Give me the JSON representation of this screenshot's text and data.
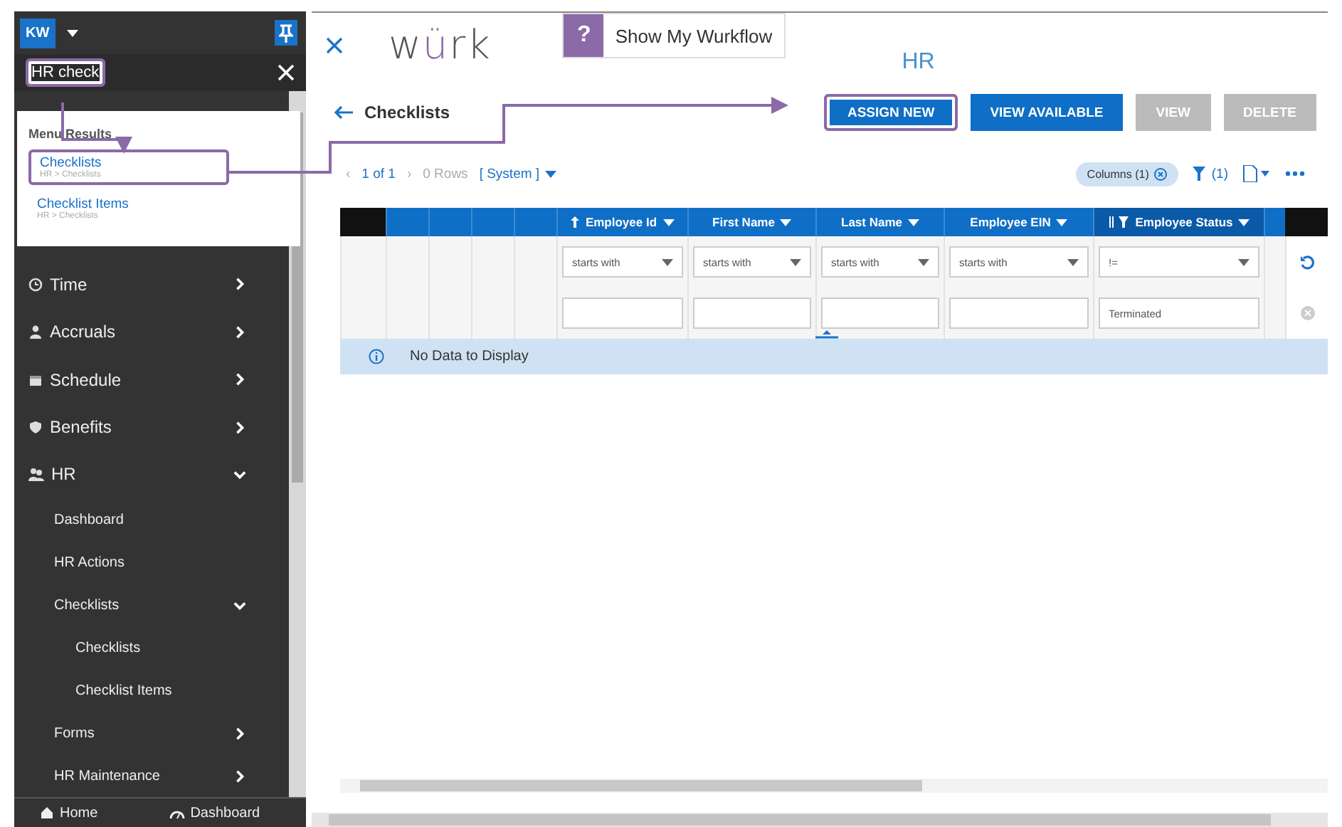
{
  "sidebar": {
    "user_initials": "KW",
    "pinned": true,
    "search": {
      "value": "HR check",
      "highlighted": true
    },
    "search_results": {
      "heading": "Menu Results",
      "items": [
        {
          "label": "Checklists",
          "path": "HR > Checklists",
          "highlighted": true
        },
        {
          "label": "Checklist Items",
          "path": "HR > Checklists",
          "highlighted": false
        }
      ]
    },
    "menu": [
      {
        "label": "Time",
        "expanded": false
      },
      {
        "label": "Accruals",
        "expanded": false
      },
      {
        "label": "Schedule",
        "expanded": false
      },
      {
        "label": "Benefits",
        "expanded": false
      },
      {
        "label": "HR",
        "expanded": true,
        "children": [
          {
            "label": "Dashboard",
            "kind": "link"
          },
          {
            "label": "HR Actions",
            "kind": "link"
          },
          {
            "label": "Checklists",
            "kind": "group",
            "expanded": true,
            "children": [
              {
                "label": "Checklists"
              },
              {
                "label": "Checklist Items"
              }
            ]
          },
          {
            "label": "Forms",
            "kind": "group",
            "expanded": false
          },
          {
            "label": "HR Maintenance",
            "kind": "group",
            "expanded": false
          }
        ]
      }
    ],
    "footer": [
      {
        "label": "Home"
      },
      {
        "label": "Dashboard"
      }
    ]
  },
  "main": {
    "logo": "würk",
    "workflow_button": {
      "icon": "?",
      "label": "Show My Wurkflow"
    },
    "module_title": "HR",
    "page_title": "Checklists",
    "buttons": [
      {
        "label": "ASSIGN NEW",
        "disabled": false,
        "highlighted": true
      },
      {
        "label": "VIEW AVAILABLE",
        "disabled": false,
        "highlighted": false
      },
      {
        "label": "VIEW",
        "disabled": true,
        "highlighted": false
      },
      {
        "label": "DELETE",
        "disabled": true,
        "highlighted": false
      }
    ],
    "pager": {
      "prev": "‹",
      "pages": "1 of 1",
      "next": "›",
      "rows": "0 Rows",
      "view": "[ System ]"
    },
    "toolbar": {
      "columns": "Columns (1)",
      "filter_count": "(1)"
    },
    "table": {
      "columns": [
        {
          "label": "Employee Id",
          "sorted": true,
          "filtered": false,
          "operator": "starts with"
        },
        {
          "label": "First Name",
          "sorted": false,
          "filtered": false,
          "operator": "starts with"
        },
        {
          "label": "Last Name",
          "sorted": false,
          "filtered": false,
          "operator": "starts with"
        },
        {
          "label": "Employee EIN",
          "sorted": false,
          "filtered": false,
          "operator": "starts with"
        },
        {
          "label": "Employee Status",
          "sorted": false,
          "filtered": true,
          "operator": "!=",
          "value": "Terminated"
        }
      ],
      "empty_message": "No Data to Display"
    }
  }
}
